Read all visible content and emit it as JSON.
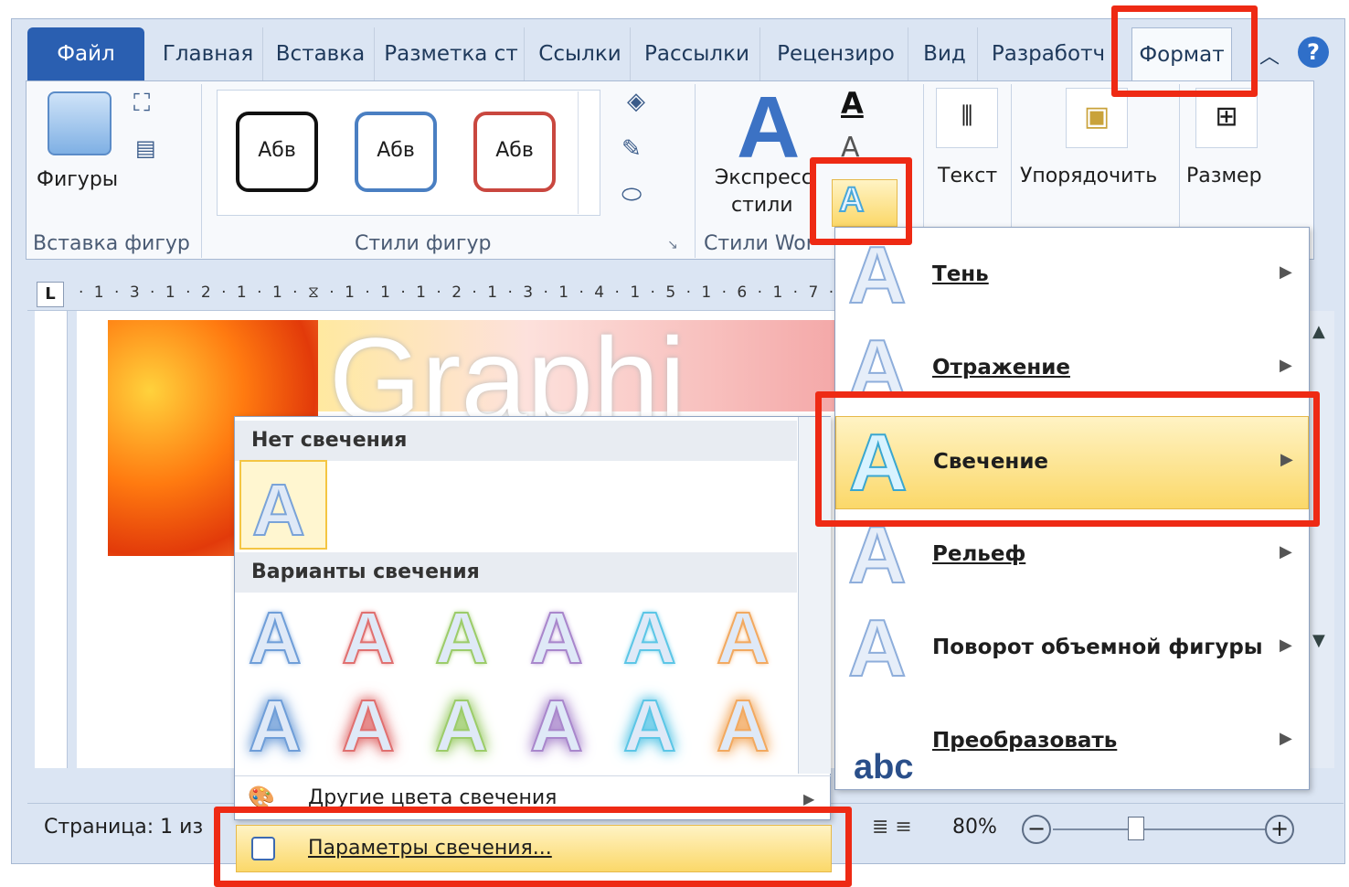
{
  "tabs": {
    "file": "Файл",
    "home": "Главная",
    "insert": "Вставка",
    "layout": "Разметка ст",
    "refs": "Ссылки",
    "mailings": "Рассылки",
    "review": "Рецензиро",
    "view": "Вид",
    "dev": "Разработч",
    "format": "Формат",
    "help": "?"
  },
  "ribbon": {
    "shapes_label": "Фигуры",
    "insert_shapes_group": "Вставка фигур",
    "style_sample": "Абв",
    "shape_styles_group": "Стили фигур",
    "express_styles_1": "Экспресс",
    "express_styles_2": "стили",
    "wordart_group": "Стили Wor",
    "text_label": "Текст",
    "arrange_label": "Упорядочить",
    "size_label": "Размер"
  },
  "ruler": {
    "marks": "· 1 · 3 · 1 · 2 · 1 · 1 · ⧖ · 1 · 1 · 1 · 2 · 1 · 3 · 1 · 4 · 1 · 5 · 1 · 6 · 1 · 7 · 1",
    "corner": "L"
  },
  "document": {
    "heading": "Graphi"
  },
  "effects_menu": {
    "items": [
      {
        "label": "Тень",
        "key": "Т"
      },
      {
        "label": "Отражение",
        "key": "О"
      },
      {
        "label": "Свечение",
        "key": "ч"
      },
      {
        "label": "Рельеф",
        "key": "Р"
      },
      {
        "label": "Поворот объемной фигуры",
        "key": "ъ"
      },
      {
        "label": "Преобразовать",
        "key": "П"
      }
    ]
  },
  "glow_gallery": {
    "no_glow_header": "Нет свечения",
    "variants_header": "Варианты свечения",
    "letter": "A",
    "other_colors": "Другие цвета свечения",
    "options": "Параметры свечения..."
  },
  "status_bar": {
    "page": "Страница: 1 из",
    "zoom": "80%"
  },
  "glow_colors": [
    "#6f9ed8",
    "#e07070",
    "#9ccc6a",
    "#a987cc",
    "#5cc6e6",
    "#f2a960"
  ],
  "accent": "#ee2a14"
}
